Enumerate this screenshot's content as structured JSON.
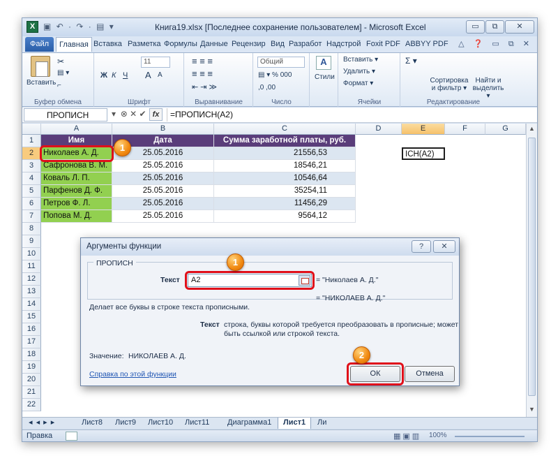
{
  "window": {
    "title": "Книга19.xlsx [Последнее сохранение пользователем] - Microsoft Excel",
    "app_icon": "X",
    "qat": "▣ ↶ · ↷ · ▤ ▾",
    "controls": {
      "minimize": "▭",
      "restore": "⧉",
      "close": "✕"
    }
  },
  "tabs": [
    "Файл",
    "Главная",
    "Вставка",
    "Разметка",
    "Формулы",
    "Данные",
    "Рецензир",
    "Вид",
    "Разработ",
    "Надстрой",
    "Foxit PDF",
    "ABBYY PDF"
  ],
  "tab_icons": "△ ❓ ▭ ⧉ ✕",
  "ribbon": {
    "groups": [
      {
        "label": "Буфер обмена",
        "items": [
          "Вставить",
          "✂",
          "▤ ▾",
          "⌐"
        ]
      },
      {
        "label": "Шрифт",
        "items": [
          "11",
          "Ж",
          "К",
          "Ч",
          "A",
          "A"
        ]
      },
      {
        "label": "Выравнивание",
        "items": [
          "≡ ≡ ≡",
          "≡ ≡ ≡",
          "⇤ ⇥ ≫"
        ]
      },
      {
        "label": "Число",
        "items": [
          "Общий",
          "▤ ▾ % 000",
          ",0 ,00"
        ]
      },
      {
        "label": "Стили",
        "items": [
          "Стили"
        ]
      },
      {
        "label": "Ячейки",
        "items": [
          "Вставить ▾",
          "Удалить ▾",
          "Формат ▾"
        ]
      },
      {
        "label": "Редактирование",
        "items": [
          "Σ ▾",
          "Сортировка и фильтр ▾",
          "Найти и выделить ▾"
        ]
      }
    ]
  },
  "formula_bar": {
    "name_box": "ПРОПИСН",
    "formula": "=ПРОПИСН(A2)",
    "fx_label": "fx"
  },
  "grid": {
    "columns": [
      "A",
      "B",
      "C",
      "D",
      "E",
      "F",
      "G"
    ],
    "rows": [
      "1",
      "2",
      "3",
      "4",
      "5",
      "6",
      "7",
      "8",
      "9",
      "10",
      "11",
      "12",
      "13",
      "14",
      "15",
      "16",
      "17",
      "18",
      "19",
      "20",
      "21",
      "22"
    ],
    "header": [
      "Имя",
      "Дата",
      "Сумма заработной платы, руб."
    ],
    "data": [
      {
        "name": "Николаев А. Д.",
        "date": "25.05.2016",
        "sum": "21556,53"
      },
      {
        "name": "Сафронова В. М.",
        "date": "25.05.2016",
        "sum": "18546,21"
      },
      {
        "name": "Коваль Л. П.",
        "date": "25.05.2016",
        "sum": "10546,64"
      },
      {
        "name": "Парфенов Д. Ф.",
        "date": "25.05.2016",
        "sum": "35254,11"
      },
      {
        "name": "Петров Ф. Л.",
        "date": "25.05.2016",
        "sum": "11456,29"
      },
      {
        "name": "Попова М. Д.",
        "date": "25.05.2016",
        "sum": "9564,12"
      }
    ],
    "active_cell_text": "ІСН(A2)"
  },
  "sheets": {
    "nav": "◂ ◂ ▸ ▸",
    "tabs": [
      "Лист8",
      "Лист9",
      "Лист10",
      "Лист11",
      "Диаграмма1",
      "Лист1",
      "Ли"
    ],
    "active": "Лист1"
  },
  "status": {
    "mode": "Правка",
    "zoom": "100%"
  },
  "dialog": {
    "title": "Аргументы функции",
    "function_name": "ПРОПИСН",
    "arg_label": "Текст",
    "arg_value": "A2",
    "arg_result": "= \"Николаев А. Д.\"",
    "formula_result": "= \"НИКОЛАЕВ А. Д.\"",
    "description": "Делает все буквы в строке текста прописными.",
    "param_name": "Текст",
    "param_desc1": "строка, буквы которой требуется преобразовать в прописные; может",
    "param_desc2": "быть ссылкой или строкой текста.",
    "value_label": "Значение:",
    "value": "НИКОЛАЕВ А. Д.",
    "help_link": "Справка по этой функции",
    "ok": "ОК",
    "cancel": "Отмена",
    "help_btn": "?",
    "close_btn": "✕"
  },
  "badges": {
    "b1": "1",
    "b2": "1",
    "b3": "2"
  },
  "accent": {
    "red": "#e0101a",
    "header_purple": "#5a3d7a",
    "name_green": "#92d050",
    "badge_orange": "#f18a12"
  }
}
